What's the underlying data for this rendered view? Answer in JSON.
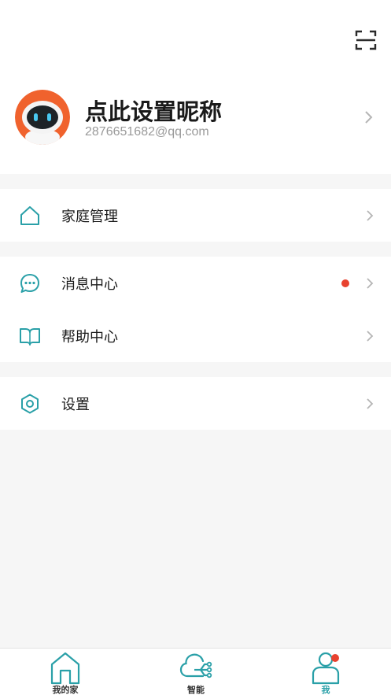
{
  "profile": {
    "nickname": "点此设置昵称",
    "email": "2876651682@qq.com"
  },
  "menu": {
    "family_management": "家庭管理",
    "message_center": "消息中心",
    "help_center": "帮助中心",
    "settings": "设置"
  },
  "tabs": [
    {
      "label": "我的家",
      "icon": "home-icon",
      "active": false
    },
    {
      "label": "智能",
      "icon": "cloud-smart-icon",
      "active": false
    },
    {
      "label": "我",
      "icon": "person-icon",
      "active": true
    }
  ],
  "colors": {
    "accent": "#2aa0a8",
    "badge": "#e8422f",
    "avatar_bg": "#f0622d"
  },
  "badges": {
    "message_center_unread": true,
    "me_tab_unread": true
  }
}
